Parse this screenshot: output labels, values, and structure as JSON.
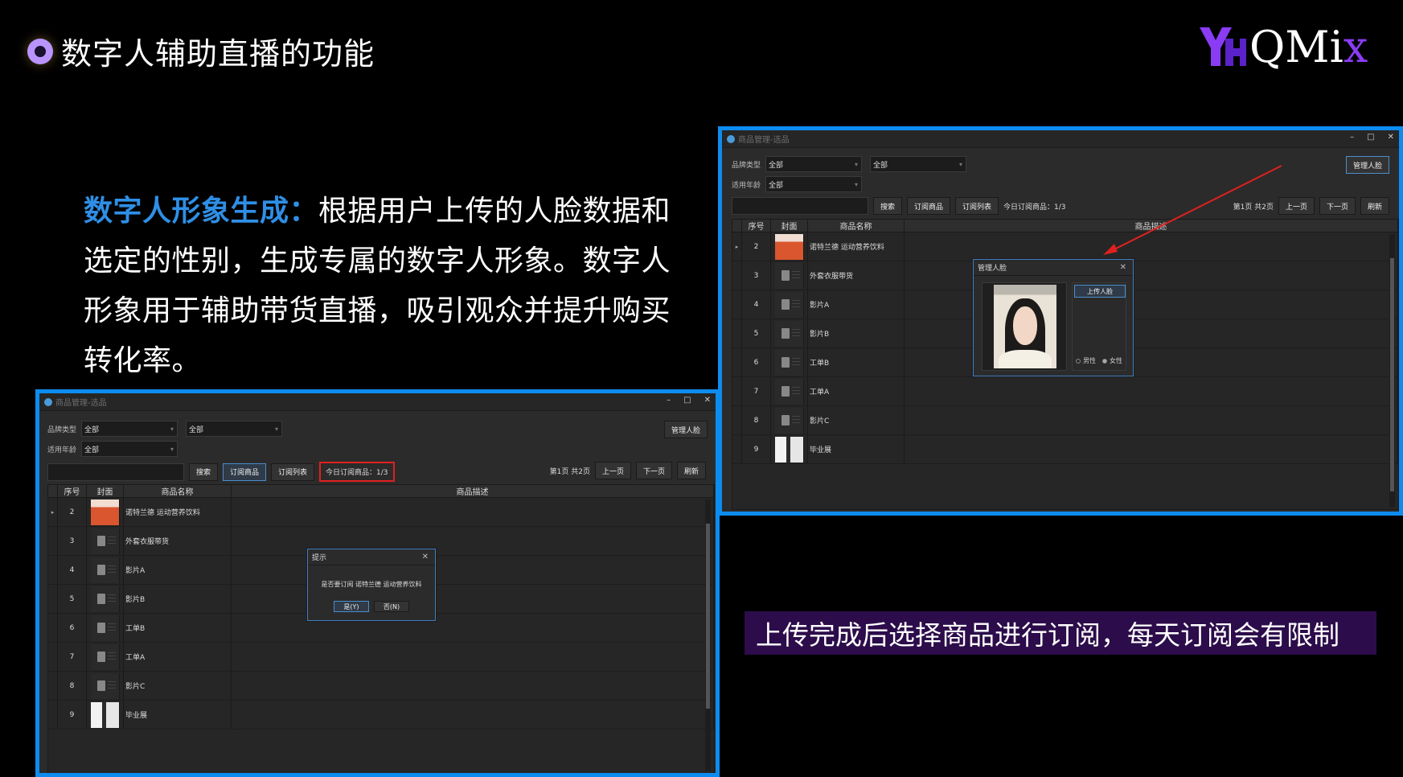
{
  "header": {
    "title": "数字人辅助直播的功能",
    "logo_text": "QMi",
    "logo_tail": "x"
  },
  "description": {
    "highlight": "数字人形象生成：",
    "text": "根据用户上传的人脸数据和选定的性别，生成专属的数字人形象。数字人形象用于辅助带货直播，吸引观众并提升购买转化率。"
  },
  "banner": "上传完成后选择商品进行订阅，每天订阅会有限制",
  "colors": {
    "accent_blue": "#0d8cf0",
    "purple": "#8a3cf5",
    "highlight": "#2f8fe6",
    "red": "#e02020"
  },
  "window": {
    "title": "商品管理-选品",
    "controls": {
      "minimize": "–",
      "maximize": "□",
      "close": "✕"
    },
    "brand_label": "品牌类型",
    "brand_value": "全部",
    "brand_value2": "全部",
    "age_label": "适用年龄",
    "age_value": "全部",
    "manage_face": "管理人脸",
    "search": "搜索",
    "subscribe": "订阅商品",
    "sub_list": "订阅列表",
    "today_count": "今日订阅商品：1/3",
    "page_info": "第1页 共2页",
    "prev": "上一页",
    "next": "下一页",
    "refresh": "刷新",
    "headers": {
      "no": "序号",
      "cover": "封面",
      "name": "商品名称",
      "desc": "商品描述"
    },
    "rows": [
      {
        "no": "2",
        "name": "诺特兰德 运动营养饮料"
      },
      {
        "no": "3",
        "name": "外套衣服带货"
      },
      {
        "no": "4",
        "name": "影片A"
      },
      {
        "no": "5",
        "name": "影片B"
      },
      {
        "no": "6",
        "name": "工单B"
      },
      {
        "no": "7",
        "name": "工单A"
      },
      {
        "no": "8",
        "name": "影片C"
      },
      {
        "no": "9",
        "name": "毕业展"
      }
    ]
  },
  "face_dialog": {
    "title": "管理人脸",
    "upload": "上传人脸",
    "male": "男性",
    "female": "女性"
  },
  "confirm_dialog": {
    "title": "提示",
    "message": "是否要订阅 诺特兰德 运动营养饮料",
    "yes": "是(Y)",
    "no": "否(N)"
  }
}
